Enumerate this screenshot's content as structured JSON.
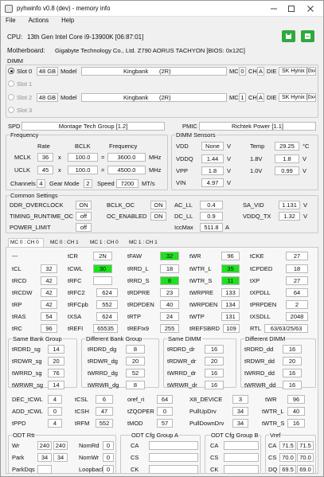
{
  "window": {
    "title": "pyhwinfo v0.8 (dev) - memory info"
  },
  "menu": [
    "File",
    "Actions",
    "Help"
  ],
  "cpu": {
    "label": "CPU:",
    "value": "13th Gen Intel Core i9-13900K [06:87:01]"
  },
  "motherboard": {
    "label": "Motherboard:",
    "value": "Gigabyte Technology Co., Ltd. Z790 AORUS TACHYON [BIOS: 0x12C]"
  },
  "dimm": {
    "title": "DIMM",
    "model_label": "Model",
    "mc_label": "MC",
    "ch_label": "CH",
    "die_label": "DIE",
    "slots": [
      {
        "label": "Slot 0",
        "size": "48 GB",
        "model": "Kingbank",
        "ranks": "(2R)",
        "mc": "0",
        "ch": "A",
        "die": "SK Hynix [0x4D]"
      },
      {
        "label": "Slot 1"
      },
      {
        "label": "Slot 2",
        "size": "48 GB",
        "model": "Kingbank",
        "ranks": "(2R)",
        "mc": "1",
        "ch": "A",
        "die": "SK Hynix [0x4D]"
      },
      {
        "label": "Slot 3"
      }
    ]
  },
  "spd": {
    "label": "SPD",
    "value": "Montage Tech Group [1.2]"
  },
  "pmic": {
    "label": "PMIC",
    "value": "Richtek Power [1.1]"
  },
  "frequency": {
    "title": "Frequency",
    "h_rate": "Rate",
    "h_bclk": "BCLK",
    "h_freq": "Frequency",
    "mclk": {
      "label": "MCLK",
      "rate": "36",
      "x": "x",
      "bclk": "100.0",
      "eq": "=",
      "freq": "3600.0",
      "unit": "MHz"
    },
    "uclk": {
      "label": "UCLK",
      "rate": "45",
      "x": "x",
      "bclk": "100.0",
      "eq": "=",
      "freq": "4500.0",
      "unit": "MHz"
    },
    "channels_label": "Channels",
    "channels": "4",
    "gear_label": "Gear Mode",
    "gear": "2",
    "speed_label": "Speed",
    "speed": "7200",
    "speed_unit": "MT/s"
  },
  "sensors": {
    "title": "DIMM Sensors",
    "vdd": {
      "label": "VDD",
      "value": "None",
      "unit": "V"
    },
    "vddq": {
      "label": "VDDQ",
      "value": "1.44",
      "unit": "V"
    },
    "vpp": {
      "label": "VPP",
      "value": "1.8",
      "unit": "V"
    },
    "vin": {
      "label": "VIN",
      "value": "4.97",
      "unit": "V"
    },
    "temp": {
      "label": "Temp",
      "value": "29.25",
      "unit": "°C"
    },
    "v18": {
      "label": "1.8V",
      "value": "1.8",
      "unit": "V"
    },
    "v10": {
      "label": "1.0V",
      "value": "0.99",
      "unit": "V"
    }
  },
  "common": {
    "title": "Common Settings",
    "ddr_overclock": {
      "label": "DDR_OVERCLOCK",
      "value": "ON"
    },
    "bclk_oc": {
      "label": "BCLK_OC",
      "value": "ON"
    },
    "ac_ll": {
      "label": "AC_LL",
      "value": "0.4"
    },
    "sa_vid": {
      "label": "SA_VID",
      "value": "1.131",
      "unit": "V"
    },
    "timing_runtime_oc": {
      "label": "TIMING_RUNTIME_OC",
      "value": "off"
    },
    "oc_enabled": {
      "label": "OC_ENABLED",
      "value": "ON"
    },
    "dc_ll": {
      "label": "DC_LL",
      "value": "0.9"
    },
    "vddq_tx": {
      "label": "VDDQ_TX",
      "value": "1.32",
      "unit": "V"
    },
    "power_limit": {
      "label": "POWER_LIMIT",
      "value": "off"
    },
    "iccmax": {
      "label": "IccMax",
      "value": "511.8",
      "unit": "A"
    }
  },
  "mc_tabs": [
    "MC 0 : CH 0",
    "MC 0 : CH 1",
    "MC 1 : CH 0",
    "MC 1 : CH 1"
  ],
  "timings": {
    "cmd": {
      "label": "---",
      "value": ""
    },
    "tcr": {
      "label": "tCR",
      "value": "2N"
    },
    "tfaw": {
      "label": "tFAW",
      "value": "32"
    },
    "twr": {
      "label": "tWR",
      "value": "96"
    },
    "tcke": {
      "label": "tCKE",
      "value": "27"
    },
    "tcl": {
      "label": "tCL",
      "value": "32"
    },
    "tcwl": {
      "label": "tCWL",
      "value": "30"
    },
    "trrd_l": {
      "label": "tRRD_L",
      "value": "18"
    },
    "twtr_l": {
      "label": "tWTR_L",
      "value": "35"
    },
    "tcpded": {
      "label": "tCPDED",
      "value": "18"
    },
    "trcd": {
      "label": "tRCD",
      "value": "42"
    },
    "trfc": {
      "label": "tRFC",
      "value": ""
    },
    "trrd_s": {
      "label": "tRRD_S",
      "value": "8"
    },
    "twtr_s": {
      "label": "tWTR_S",
      "value": "11"
    },
    "txp": {
      "label": "tXP",
      "value": "27"
    },
    "trcdw": {
      "label": "tRCDW",
      "value": "42"
    },
    "trfc2": {
      "label": "tRFC2",
      "value": "624"
    },
    "trdpre": {
      "label": "tRDPRE",
      "value": "23"
    },
    "twrpre": {
      "label": "tWRPRE",
      "value": "133"
    },
    "txpdll": {
      "label": "tXPDLL",
      "value": "64"
    },
    "trp": {
      "label": "tRP",
      "value": "42"
    },
    "trfcpb": {
      "label": "tRFCpb",
      "value": "552"
    },
    "trdpden": {
      "label": "tRDPDEN",
      "value": "40"
    },
    "twrpden": {
      "label": "tWRPDEN",
      "value": "134"
    },
    "tprpden": {
      "label": "tPRPDEN",
      "value": "2"
    },
    "tras": {
      "label": "tRAS",
      "value": "54"
    },
    "txsa": {
      "label": "tXSA",
      "value": "624"
    },
    "trtp": {
      "label": "tRTP",
      "value": "24"
    },
    "twtp": {
      "label": "tWTP",
      "value": "131"
    },
    "txsdll": {
      "label": "tXSDLL",
      "value": "2048"
    },
    "trc": {
      "label": "tRC",
      "value": "96"
    },
    "trefi": {
      "label": "tREFI",
      "value": "65535"
    },
    "trefix9": {
      "label": "tREFIx9",
      "value": "255"
    },
    "trefsbrd": {
      "label": "tREFSBRD",
      "value": "109"
    },
    "rtl": {
      "label": "RTL",
      "value": "63/63/25/63"
    }
  },
  "turnaround": {
    "same_bank": {
      "title": "Same Bank Group",
      "rows": [
        {
          "label": "tRDRD_sg",
          "value": "14"
        },
        {
          "label": "tRDWR_sg",
          "value": "20"
        },
        {
          "label": "tWRRD_sg",
          "value": "76"
        },
        {
          "label": "tWRWR_sg",
          "value": "14"
        }
      ]
    },
    "diff_bank": {
      "title": "Different Bank Group",
      "rows": [
        {
          "label": "tRDRD_dg",
          "value": "8"
        },
        {
          "label": "tRDWR_dg",
          "value": "20"
        },
        {
          "label": "tWRRD_dg",
          "value": "52"
        },
        {
          "label": "tWRWR_dg",
          "value": "8"
        }
      ]
    },
    "same_dimm": {
      "title": "Same DIMM",
      "rows": [
        {
          "label": "tRDRD_dr",
          "value": "16"
        },
        {
          "label": "tRDWR_dr",
          "value": "20"
        },
        {
          "label": "tWRRD_dr",
          "value": "16"
        },
        {
          "label": "tWRWR_dr",
          "value": "16"
        }
      ]
    },
    "diff_dimm": {
      "title": "Different DIMM",
      "rows": [
        {
          "label": "tRDRD_dd",
          "value": "16"
        },
        {
          "label": "tRDWR_dd",
          "value": "20"
        },
        {
          "label": "tWRRD_dd",
          "value": "16"
        },
        {
          "label": "tWRWR_dd",
          "value": "16"
        }
      ]
    }
  },
  "misc": {
    "dec_tcwl": {
      "label": "DEC_tCWL",
      "value": "4"
    },
    "tcsl": {
      "label": "tCSL",
      "value": "6"
    },
    "oref_ri": {
      "label": "oref_ri",
      "value": "64"
    },
    "x8_device": {
      "label": "X8_DEVICE",
      "value": "3"
    },
    "twr": {
      "label": "tWR",
      "value": "96"
    },
    "add_tcwl": {
      "label": "ADD_tCWL",
      "value": "0"
    },
    "tcsh": {
      "label": "tCSH",
      "value": "47"
    },
    "tzqoper": {
      "label": "tZQOPER",
      "value": "0"
    },
    "pullupdrv": {
      "label": "PullUpDrv",
      "value": "34"
    },
    "twtr_l": {
      "label": "tWTR_L",
      "value": "40"
    },
    "tppd": {
      "label": "tPPD",
      "value": "4"
    },
    "trfm": {
      "label": "tRFM",
      "value": "552"
    },
    "tmod": {
      "label": "tMOD",
      "value": "57"
    },
    "pulldowndrv": {
      "label": "PullDownDrv",
      "value": "34"
    },
    "twtr_s": {
      "label": "tWTR_S",
      "value": "16"
    }
  },
  "odt": {
    "title": "ODT Rtt",
    "wr": {
      "label": "Wr",
      "a": "240",
      "b": "240"
    },
    "park": {
      "label": "Park",
      "a": "34",
      "b": "34"
    },
    "parkdqs": {
      "label": "ParkDqs",
      "a": ""
    },
    "nomrd": {
      "label": "NomRd",
      "value": "0"
    },
    "nomwr": {
      "label": "NomWr",
      "value": "0"
    },
    "loopback": {
      "label": "Loopback",
      "value": "0"
    }
  },
  "odt_a": {
    "title": "ODT Cfg Group A",
    "rows": [
      {
        "label": "CA",
        "value": ""
      },
      {
        "label": "CS",
        "value": ""
      },
      {
        "label": "CK",
        "value": ""
      }
    ]
  },
  "odt_b": {
    "title": "ODT Cfg Group B",
    "rows": [
      {
        "label": "CA",
        "value": ""
      },
      {
        "label": "CS",
        "value": ""
      },
      {
        "label": "CK",
        "value": ""
      }
    ]
  },
  "vref": {
    "title": "Vref",
    "rows": [
      {
        "label": "CA",
        "a": "71.5",
        "b": "71.5"
      },
      {
        "label": "CS",
        "a": "70.0",
        "b": "70.0"
      },
      {
        "label": "DQ",
        "a": "69.5",
        "b": "69.0"
      }
    ]
  },
  "colors": {
    "highlight": "#1ee11e",
    "button": "#2eaa3c"
  }
}
